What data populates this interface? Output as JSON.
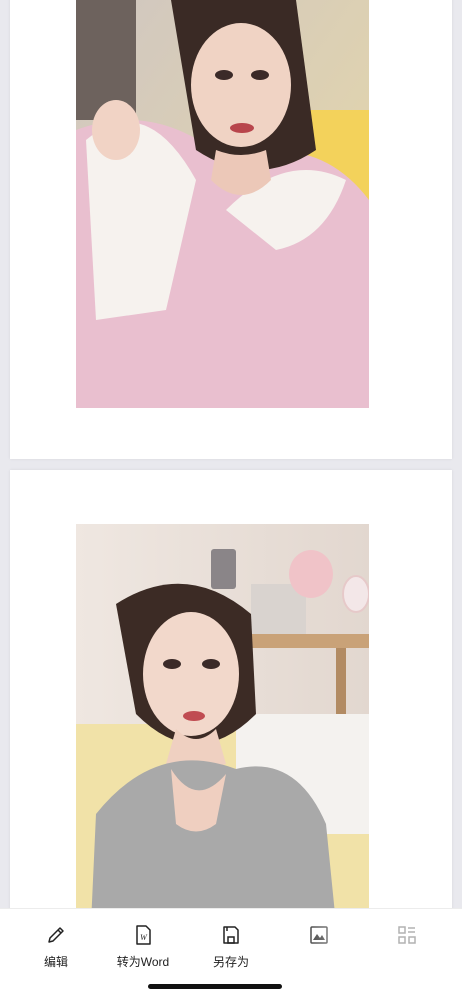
{
  "document": {
    "pages": [
      {
        "image": "selfie-pink-robe-photo"
      },
      {
        "image": "selfie-gray-top-photo"
      }
    ]
  },
  "toolbar": {
    "items": [
      {
        "label": "编辑",
        "icon": "pencil-icon"
      },
      {
        "label": "转为Word",
        "icon": "word-document-icon"
      },
      {
        "label": "另存为",
        "icon": "save-disk-icon"
      },
      {
        "label": "",
        "icon": "image-icon"
      },
      {
        "label": "",
        "icon": "grid-menu-icon"
      }
    ]
  }
}
